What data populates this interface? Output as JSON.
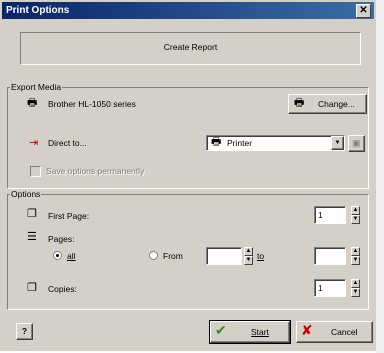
{
  "window": {
    "title": "Print Options",
    "close_glyph": "✕"
  },
  "banner": {
    "text": "Create Report"
  },
  "export_media": {
    "group_title": "Export Media",
    "printer_name": "Brother HL-1050 series",
    "change_button": "Change...",
    "direct_to_label": "Direct to...",
    "direct_to_value": "Printer",
    "save_options_label": "Save options permanently"
  },
  "options": {
    "group_title": "Options",
    "first_page_label": "First Page:",
    "first_page_value": "1",
    "pages_label": "Pages:",
    "all_label": "all",
    "from_label": "From",
    "from_value": "",
    "to_label": "to",
    "to_value": "",
    "copies_label": "Copies:",
    "copies_value": "1"
  },
  "footer": {
    "help_glyph": "?",
    "start_label": "Start",
    "cancel_label": "Cancel"
  },
  "icons": {
    "printer": "🖶",
    "direct": "⇥",
    "page": "❐",
    "pages": "☰",
    "check": "✔",
    "cross": "✘",
    "arrow_up": "▲",
    "arrow_down": "▼",
    "dropdown": "▼"
  },
  "colors": {
    "title_bar": "#0a246a",
    "start_check": "#2e8b2e",
    "cancel_cross": "#cc0000"
  }
}
